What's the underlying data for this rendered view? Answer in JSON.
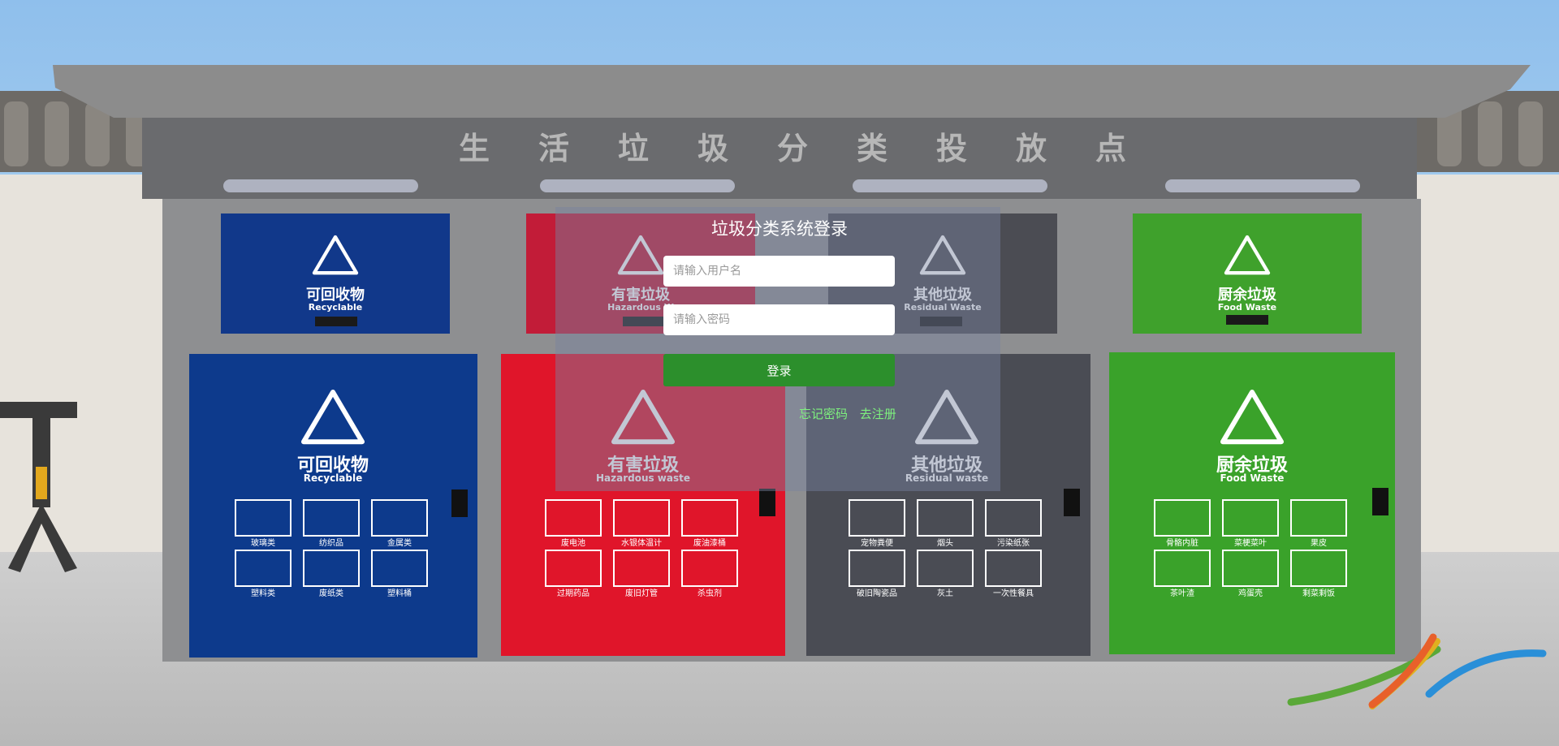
{
  "login": {
    "title": "垃圾分类系统登录",
    "username_placeholder": "请输入用户名",
    "password_placeholder": "请输入密码",
    "submit_label": "登录",
    "forgot_label": "忘记密码",
    "register_label": "去注册"
  },
  "scene": {
    "shelter_title": "生活垃圾分类投放点",
    "bins": [
      {
        "cn": "可回收物",
        "en": "Recyclable",
        "color": "#0d3a8c",
        "items": [
          "玻璃类",
          "纺织品",
          "金属类",
          "塑料类",
          "废纸类",
          "塑料桶"
        ]
      },
      {
        "cn": "有害垃圾",
        "en": "Hazardous waste",
        "color": "#e0152a",
        "items": [
          "废电池",
          "水银体温计",
          "废油漆桶",
          "过期药品",
          "废旧灯管",
          "杀虫剂"
        ]
      },
      {
        "cn": "其他垃圾",
        "en": "Residual waste",
        "color": "#4a4c54",
        "items": [
          "宠物粪便",
          "烟头",
          "污染纸张",
          "破旧陶瓷品",
          "灰土",
          "一次性餐具"
        ]
      },
      {
        "cn": "厨余垃圾",
        "en": "Food Waste",
        "color": "#3aa22a",
        "items": [
          "骨骼内脏",
          "菜梗菜叶",
          "果皮",
          "茶叶渣",
          "鸡蛋壳",
          "剩菜剩饭"
        ]
      }
    ],
    "top_bins": [
      {
        "cn": "可回收物",
        "en": "Recyclable"
      },
      {
        "cn": "有害垃圾",
        "en": "Hazardous W"
      },
      {
        "cn": "其他垃圾",
        "en": "Residual Waste"
      },
      {
        "cn": "厨余垃圾",
        "en": "Food Waste"
      }
    ]
  }
}
